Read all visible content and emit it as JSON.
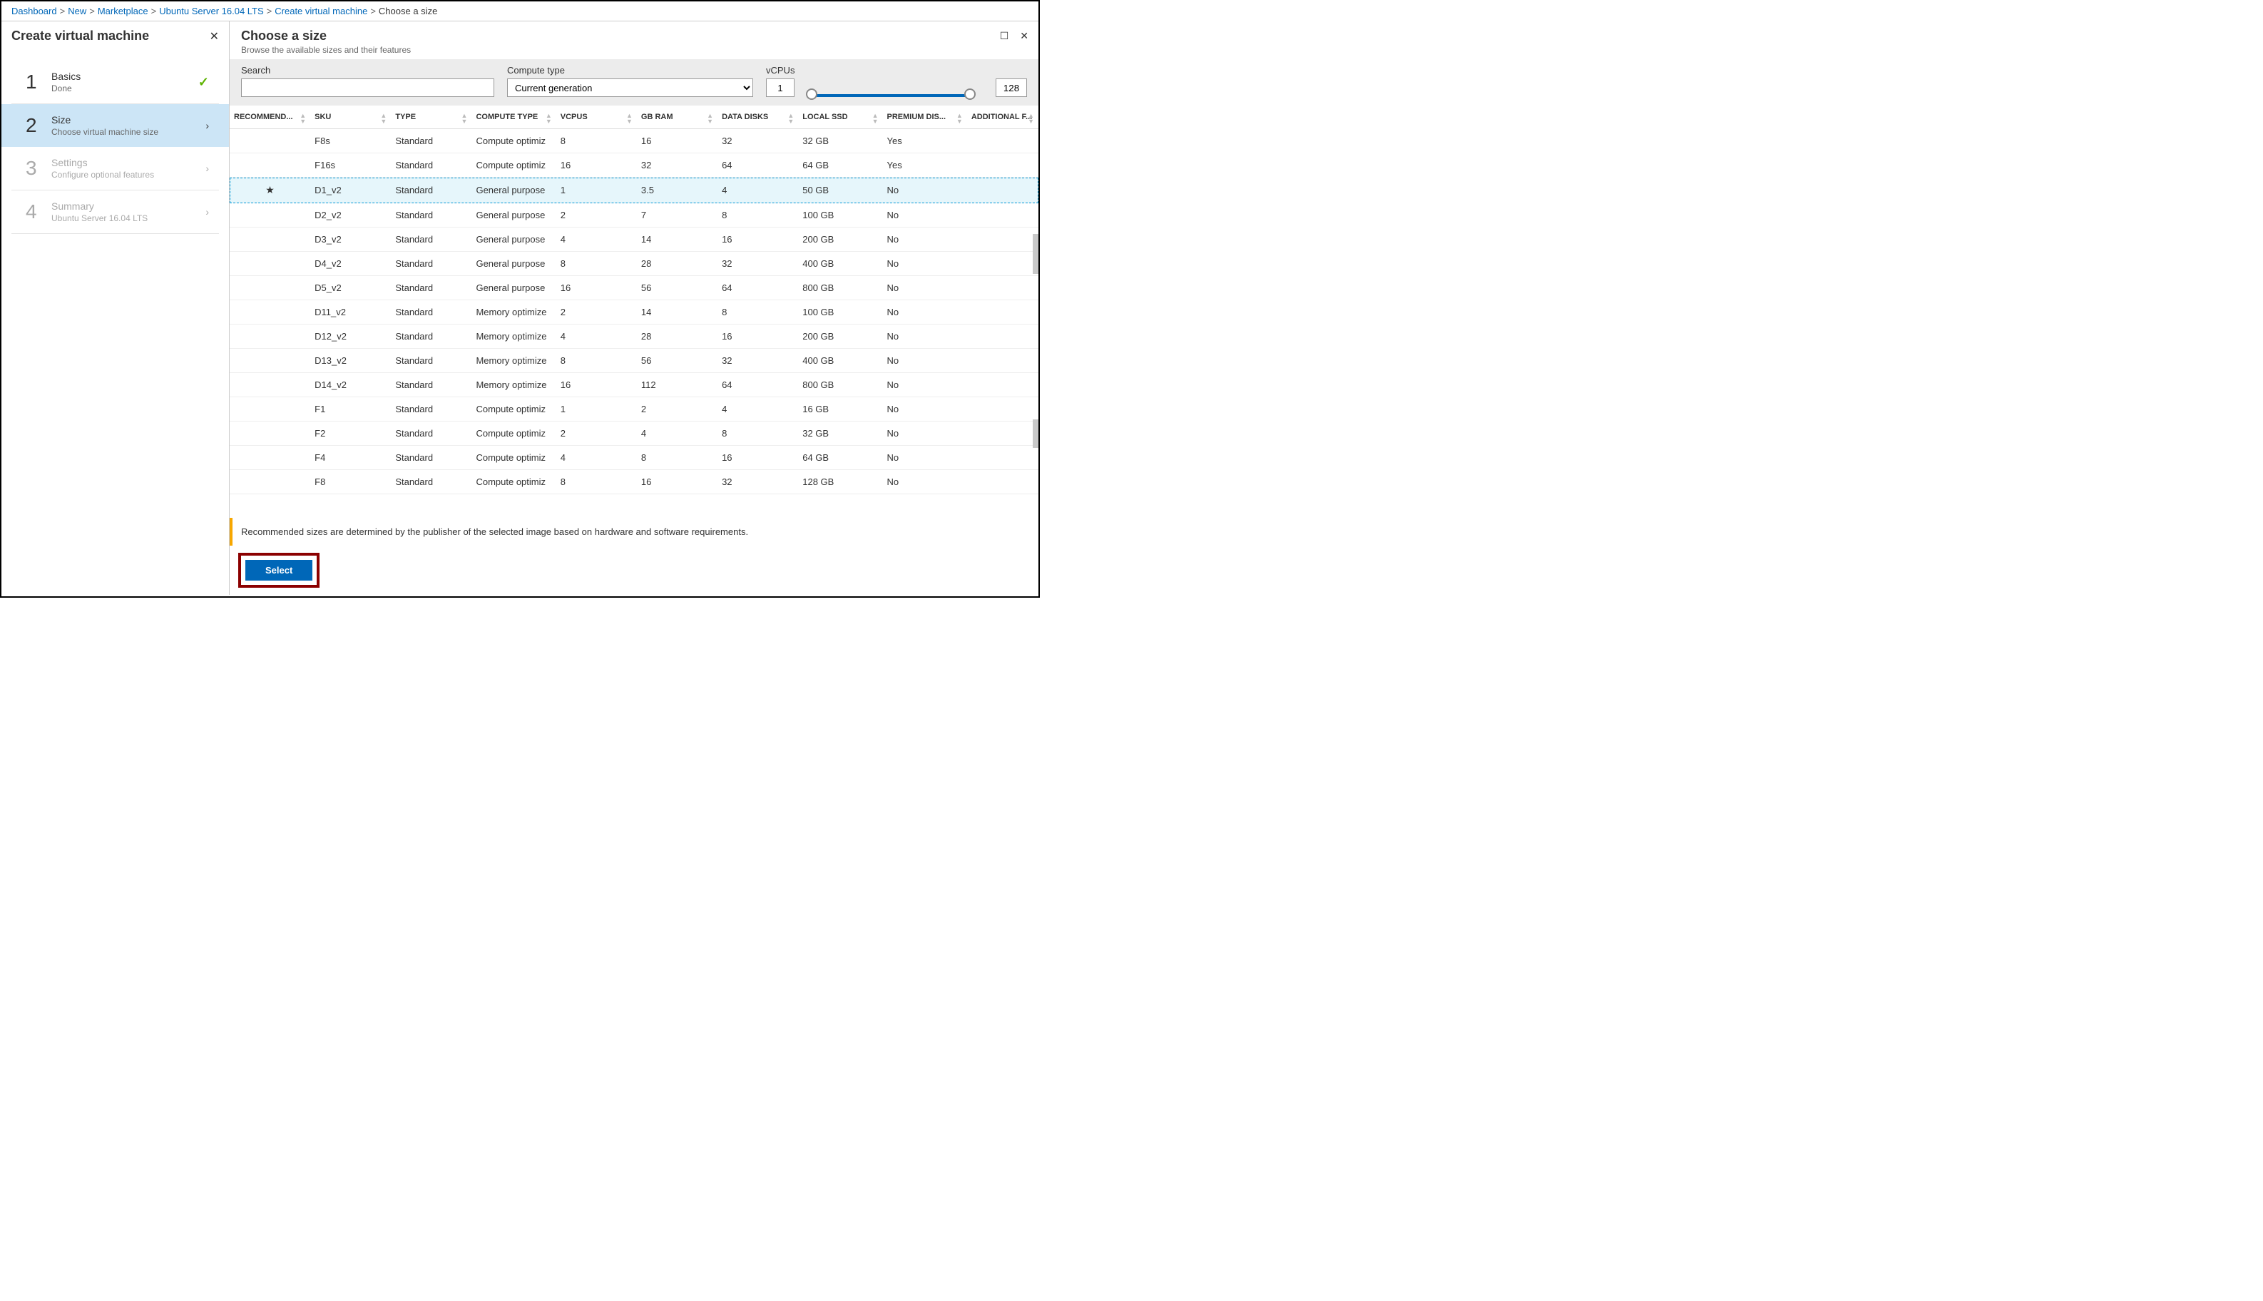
{
  "breadcrumb": [
    {
      "label": "Dashboard",
      "link": true
    },
    {
      "label": "New",
      "link": true
    },
    {
      "label": "Marketplace",
      "link": true
    },
    {
      "label": "Ubuntu Server 16.04 LTS",
      "link": true
    },
    {
      "label": "Create virtual machine",
      "link": true
    },
    {
      "label": "Choose a size",
      "link": false
    }
  ],
  "left": {
    "title": "Create virtual machine",
    "steps": [
      {
        "num": "1",
        "title": "Basics",
        "sub": "Done",
        "status": "done"
      },
      {
        "num": "2",
        "title": "Size",
        "sub": "Choose virtual machine size",
        "status": "active"
      },
      {
        "num": "3",
        "title": "Settings",
        "sub": "Configure optional features",
        "status": "disabled"
      },
      {
        "num": "4",
        "title": "Summary",
        "sub": "Ubuntu Server 16.04 LTS",
        "status": "disabled"
      }
    ]
  },
  "right": {
    "title": "Choose a size",
    "subtitle": "Browse the available sizes and their features"
  },
  "filters": {
    "search_label": "Search",
    "search_value": "",
    "compute_label": "Compute type",
    "compute_value": "Current generation",
    "vcpus_label": "vCPUs",
    "vcpus_min": "1",
    "vcpus_max": "128"
  },
  "columns": [
    "RECOMMEND...",
    "SKU",
    "TYPE",
    "COMPUTE TYPE",
    "VCPUS",
    "GB RAM",
    "DATA DISKS",
    "LOCAL SSD",
    "PREMIUM DIS...",
    "ADDITIONAL F..."
  ],
  "rows": [
    {
      "star": "",
      "sku": "F8s",
      "type": "Standard",
      "compute": "Compute optimiz",
      "vcpus": "8",
      "ram": "16",
      "disks": "32",
      "ssd": "32 GB",
      "premium": "Yes",
      "extra": "",
      "selected": false
    },
    {
      "star": "",
      "sku": "F16s",
      "type": "Standard",
      "compute": "Compute optimiz",
      "vcpus": "16",
      "ram": "32",
      "disks": "64",
      "ssd": "64 GB",
      "premium": "Yes",
      "extra": "",
      "selected": false
    },
    {
      "star": "★",
      "sku": "D1_v2",
      "type": "Standard",
      "compute": "General purpose",
      "vcpus": "1",
      "ram": "3.5",
      "disks": "4",
      "ssd": "50 GB",
      "premium": "No",
      "extra": "",
      "selected": true
    },
    {
      "star": "",
      "sku": "D2_v2",
      "type": "Standard",
      "compute": "General purpose",
      "vcpus": "2",
      "ram": "7",
      "disks": "8",
      "ssd": "100 GB",
      "premium": "No",
      "extra": "",
      "selected": false
    },
    {
      "star": "",
      "sku": "D3_v2",
      "type": "Standard",
      "compute": "General purpose",
      "vcpus": "4",
      "ram": "14",
      "disks": "16",
      "ssd": "200 GB",
      "premium": "No",
      "extra": "",
      "selected": false
    },
    {
      "star": "",
      "sku": "D4_v2",
      "type": "Standard",
      "compute": "General purpose",
      "vcpus": "8",
      "ram": "28",
      "disks": "32",
      "ssd": "400 GB",
      "premium": "No",
      "extra": "",
      "selected": false
    },
    {
      "star": "",
      "sku": "D5_v2",
      "type": "Standard",
      "compute": "General purpose",
      "vcpus": "16",
      "ram": "56",
      "disks": "64",
      "ssd": "800 GB",
      "premium": "No",
      "extra": "",
      "selected": false
    },
    {
      "star": "",
      "sku": "D11_v2",
      "type": "Standard",
      "compute": "Memory optimize",
      "vcpus": "2",
      "ram": "14",
      "disks": "8",
      "ssd": "100 GB",
      "premium": "No",
      "extra": "",
      "selected": false
    },
    {
      "star": "",
      "sku": "D12_v2",
      "type": "Standard",
      "compute": "Memory optimize",
      "vcpus": "4",
      "ram": "28",
      "disks": "16",
      "ssd": "200 GB",
      "premium": "No",
      "extra": "",
      "selected": false
    },
    {
      "star": "",
      "sku": "D13_v2",
      "type": "Standard",
      "compute": "Memory optimize",
      "vcpus": "8",
      "ram": "56",
      "disks": "32",
      "ssd": "400 GB",
      "premium": "No",
      "extra": "",
      "selected": false
    },
    {
      "star": "",
      "sku": "D14_v2",
      "type": "Standard",
      "compute": "Memory optimize",
      "vcpus": "16",
      "ram": "112",
      "disks": "64",
      "ssd": "800 GB",
      "premium": "No",
      "extra": "",
      "selected": false
    },
    {
      "star": "",
      "sku": "F1",
      "type": "Standard",
      "compute": "Compute optimiz",
      "vcpus": "1",
      "ram": "2",
      "disks": "4",
      "ssd": "16 GB",
      "premium": "No",
      "extra": "",
      "selected": false
    },
    {
      "star": "",
      "sku": "F2",
      "type": "Standard",
      "compute": "Compute optimiz",
      "vcpus": "2",
      "ram": "4",
      "disks": "8",
      "ssd": "32 GB",
      "premium": "No",
      "extra": "",
      "selected": false
    },
    {
      "star": "",
      "sku": "F4",
      "type": "Standard",
      "compute": "Compute optimiz",
      "vcpus": "4",
      "ram": "8",
      "disks": "16",
      "ssd": "64 GB",
      "premium": "No",
      "extra": "",
      "selected": false
    },
    {
      "star": "",
      "sku": "F8",
      "type": "Standard",
      "compute": "Compute optimiz",
      "vcpus": "8",
      "ram": "16",
      "disks": "32",
      "ssd": "128 GB",
      "premium": "No",
      "extra": "",
      "selected": false
    }
  ],
  "note": "Recommended sizes are determined by the publisher of the selected image based on hardware and software requirements.",
  "select_label": "Select"
}
